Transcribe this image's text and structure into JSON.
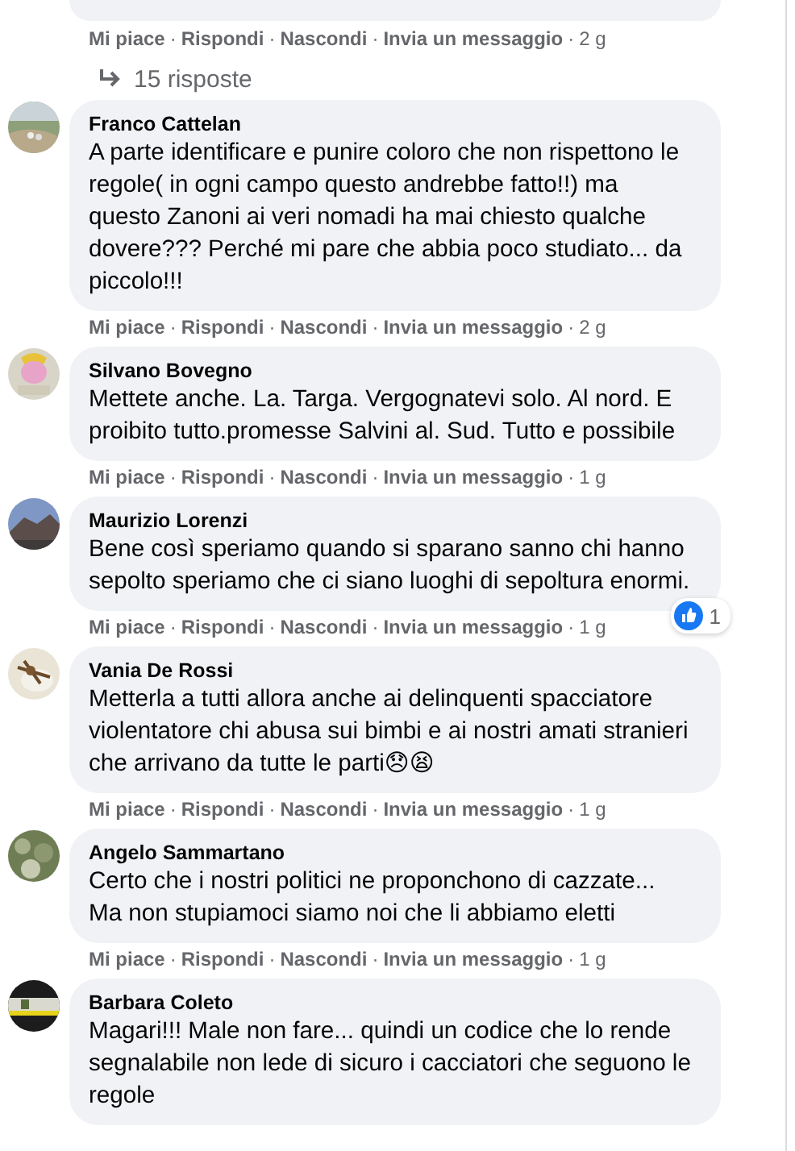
{
  "separator": "·",
  "top_thread": {
    "actions": [
      "Mi piace",
      "Rispondi",
      "Nascondi",
      "Invia un messaggio"
    ],
    "time": "2 g",
    "replies": "15 risposte"
  },
  "comments": [
    {
      "author": "Franco Cattelan",
      "text": "A parte identificare e punire coloro che non rispettono le regole( in ogni campo questo andrebbe fatto!!) ma questo Zanoni ai veri nomadi ha mai chiesto qualche dovere??? Perché mi pare che abbia poco studiato... da piccolo!!!",
      "actions": [
        "Mi piace",
        "Rispondi",
        "Nascondi",
        "Invia un messaggio"
      ],
      "time": "2 g"
    },
    {
      "author": "Silvano Bovegno",
      "text": "Mettete anche. La. Targa. Vergognatevi solo. Al nord. E proibito tutto.promesse Salvini al. Sud. Tutto e possibile",
      "actions": [
        "Mi piace",
        "Rispondi",
        "Nascondi",
        "Invia un messaggio"
      ],
      "time": "1 g"
    },
    {
      "author": "Maurizio Lorenzi",
      "text": "Bene così speriamo quando si sparano sanno chi hanno sepolto speriamo che ci siano luoghi di sepoltura enormi.",
      "actions": [
        "Mi piace",
        "Rispondi",
        "Nascondi",
        "Invia un messaggio"
      ],
      "time": "1 g",
      "reaction_count": "1"
    },
    {
      "author": "Vania De Rossi",
      "text": "Metterla a tutti allora anche ai delinquenti spacciatore violentatore chi abusa sui bimbi e ai nostri amati stranieri che arrivano da tutte le parti😞😫",
      "actions": [
        "Mi piace",
        "Rispondi",
        "Nascondi",
        "Invia un messaggio"
      ],
      "time": "1 g"
    },
    {
      "author": "Angelo Sammartano",
      "text": "Certo che i nostri politici ne proponchono di cazzate... Ma non stupiamoci siamo noi che li abbiamo eletti",
      "actions": [
        "Mi piace",
        "Rispondi",
        "Nascondi",
        "Invia un messaggio"
      ],
      "time": "1 g"
    },
    {
      "author": "Barbara Coleto",
      "text": "Magari!!! Male non fare... quindi un codice che lo rende segnalabile non lede di sicuro i cacciatori che seguono le regole"
    }
  ]
}
